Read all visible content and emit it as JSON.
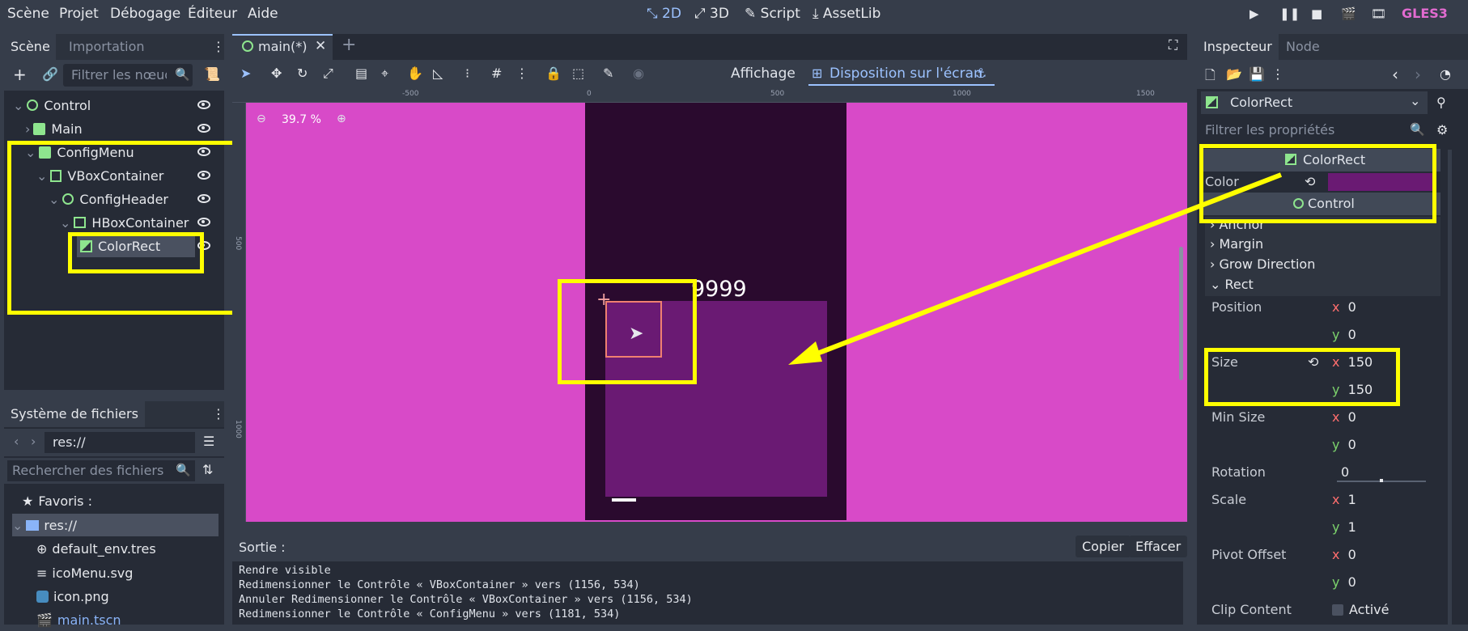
{
  "menu": {
    "items": [
      "Scène",
      "Projet",
      "Débogage",
      "Éditeur",
      "Aide"
    ]
  },
  "workspaces": {
    "2d": "2D",
    "3d": "3D",
    "script": "Script",
    "assetlib": "AssetLib"
  },
  "renderer": "GLES3",
  "scene_dock": {
    "tab_scene": "Scène",
    "tab_import": "Importation",
    "filter_placeholder": "Filtrer les nœuds",
    "tree": [
      {
        "label": "Control",
        "icon": "control-node-icon"
      },
      {
        "label": "Main",
        "icon": "node-icon"
      },
      {
        "label": "ConfigMenu",
        "icon": "node-icon"
      },
      {
        "label": "VBoxContainer",
        "icon": "vbox-icon"
      },
      {
        "label": "ConfigHeader",
        "icon": "control-node-icon"
      },
      {
        "label": "HBoxContainer",
        "icon": "hbox-icon"
      },
      {
        "label": "ColorRect",
        "icon": "colorrect-icon"
      }
    ]
  },
  "fs_dock": {
    "title": "Système de fichiers",
    "path": "res://",
    "search_placeholder": "Rechercher des fichiers",
    "favorites": "Favoris :",
    "root": "res://",
    "files": [
      "default_env.tres",
      "icoMenu.svg",
      "icon.png",
      "main.tscn"
    ]
  },
  "editor": {
    "tab_label": "main(*)",
    "toolbar_view": "Affichage",
    "toolbar_layout": "Disposition sur l'écran",
    "zoom": "39.7 %",
    "ruler_labels": [
      "-500",
      "0",
      "500",
      "1000",
      "1500"
    ],
    "ruler_v_labels": [
      "500",
      "1000"
    ],
    "canvas_text": "9999"
  },
  "output": {
    "title": "Sortie :",
    "copy": "Copier",
    "clear": "Effacer",
    "lines": [
      "Rendre visible",
      "Redimensionner le Contrôle « VBoxContainer » vers (1156, 534)",
      "Annuler Redimensionner le Contrôle « VBoxContainer » vers (1156, 534)",
      "Redimensionner le Contrôle « ConfigMenu » vers (1181, 534)"
    ]
  },
  "inspector": {
    "tab_inspector": "Inspecteur",
    "tab_node": "Node",
    "object_name": "ColorRect",
    "filter_placeholder": "Filtrer les propriétés",
    "section_colorrect": "ColorRect",
    "color_label": "Color",
    "color_value": "#6a1a73",
    "section_control": "Control",
    "groups": [
      "Anchor",
      "Margin",
      "Grow Direction",
      "Rect"
    ],
    "position_label": "Position",
    "position": {
      "x": "0",
      "y": "0"
    },
    "size_label": "Size",
    "size": {
      "x": "150",
      "y": "150"
    },
    "min_size_label": "Min Size",
    "min_size": {
      "x": "0",
      "y": "0"
    },
    "rotation_label": "Rotation",
    "rotation": "0",
    "scale_label": "Scale",
    "scale": {
      "x": "1",
      "y": "1"
    },
    "pivot_label": "Pivot Offset",
    "pivot": {
      "x": "0",
      "y": "0"
    },
    "clip_label": "Clip Content",
    "clip_value": "Activé",
    "axis_x": "x",
    "axis_y": "y"
  },
  "colors": {
    "accent": "#9cc2ff",
    "highlight": "#ffff00",
    "canvas_magenta": "#d84ac8",
    "canvas_dark": "#2a0a2e",
    "colorrect": "#6a1a73"
  }
}
